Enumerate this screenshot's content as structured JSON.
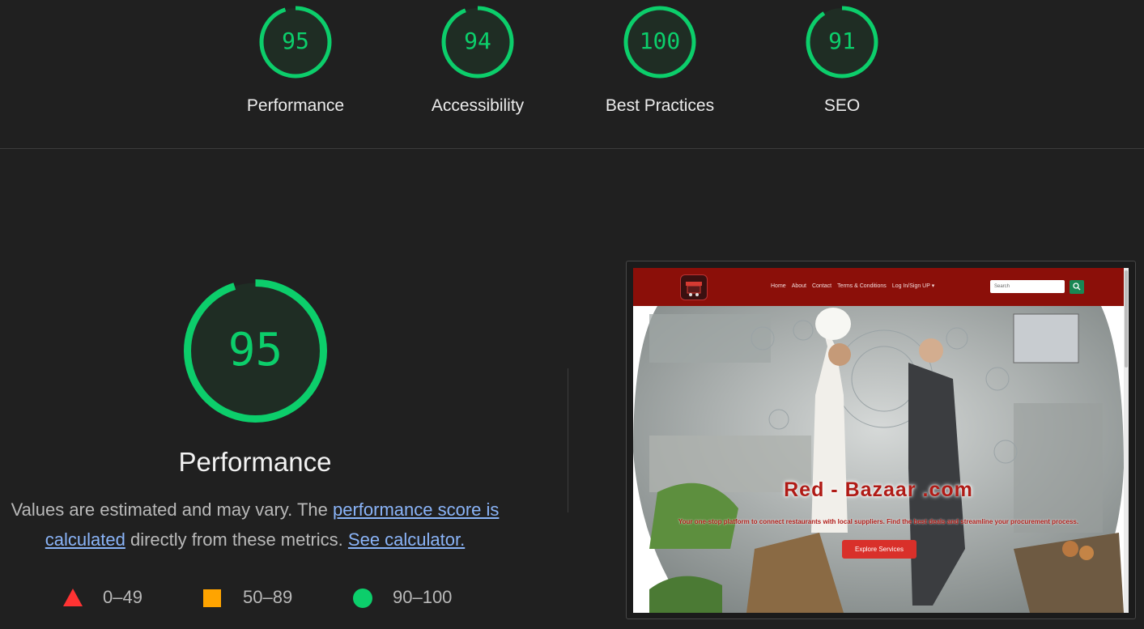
{
  "colors": {
    "pass": "#0cce6b",
    "average": "#ffa400",
    "fail": "#ff3333",
    "background": "#202020"
  },
  "categories": [
    {
      "score": "95",
      "label": "Performance",
      "fraction": 0.95
    },
    {
      "score": "94",
      "label": "Accessibility",
      "fraction": 0.94
    },
    {
      "score": "100",
      "label": "Best Practices",
      "fraction": 1.0
    },
    {
      "score": "91",
      "label": "SEO",
      "fraction": 0.91
    }
  ],
  "performance": {
    "score": "95",
    "fraction": 0.95,
    "title": "Performance",
    "desc_prefix": "Values are estimated and may vary. The ",
    "link_score": "performance score is calculated",
    "desc_middle": " directly from these metrics. ",
    "link_calculator": "See calculator."
  },
  "legend": [
    {
      "icon": "triangle-icon",
      "range": "0–49"
    },
    {
      "icon": "square-icon",
      "range": "50–89"
    },
    {
      "icon": "circle-icon",
      "range": "90–100"
    }
  ],
  "screenshot": {
    "nav": [
      "Home",
      "About",
      "Contact",
      "Terms & Conditions",
      "Log In/Sign UP ▾"
    ],
    "search_placeholder": "Search",
    "hero_title": "Red - Bazaar .com",
    "hero_subtitle": "Your one-stop platform to connect restaurants with local suppliers. Find the best deals and streamline your procurement process.",
    "hero_button": "Explore Services"
  }
}
